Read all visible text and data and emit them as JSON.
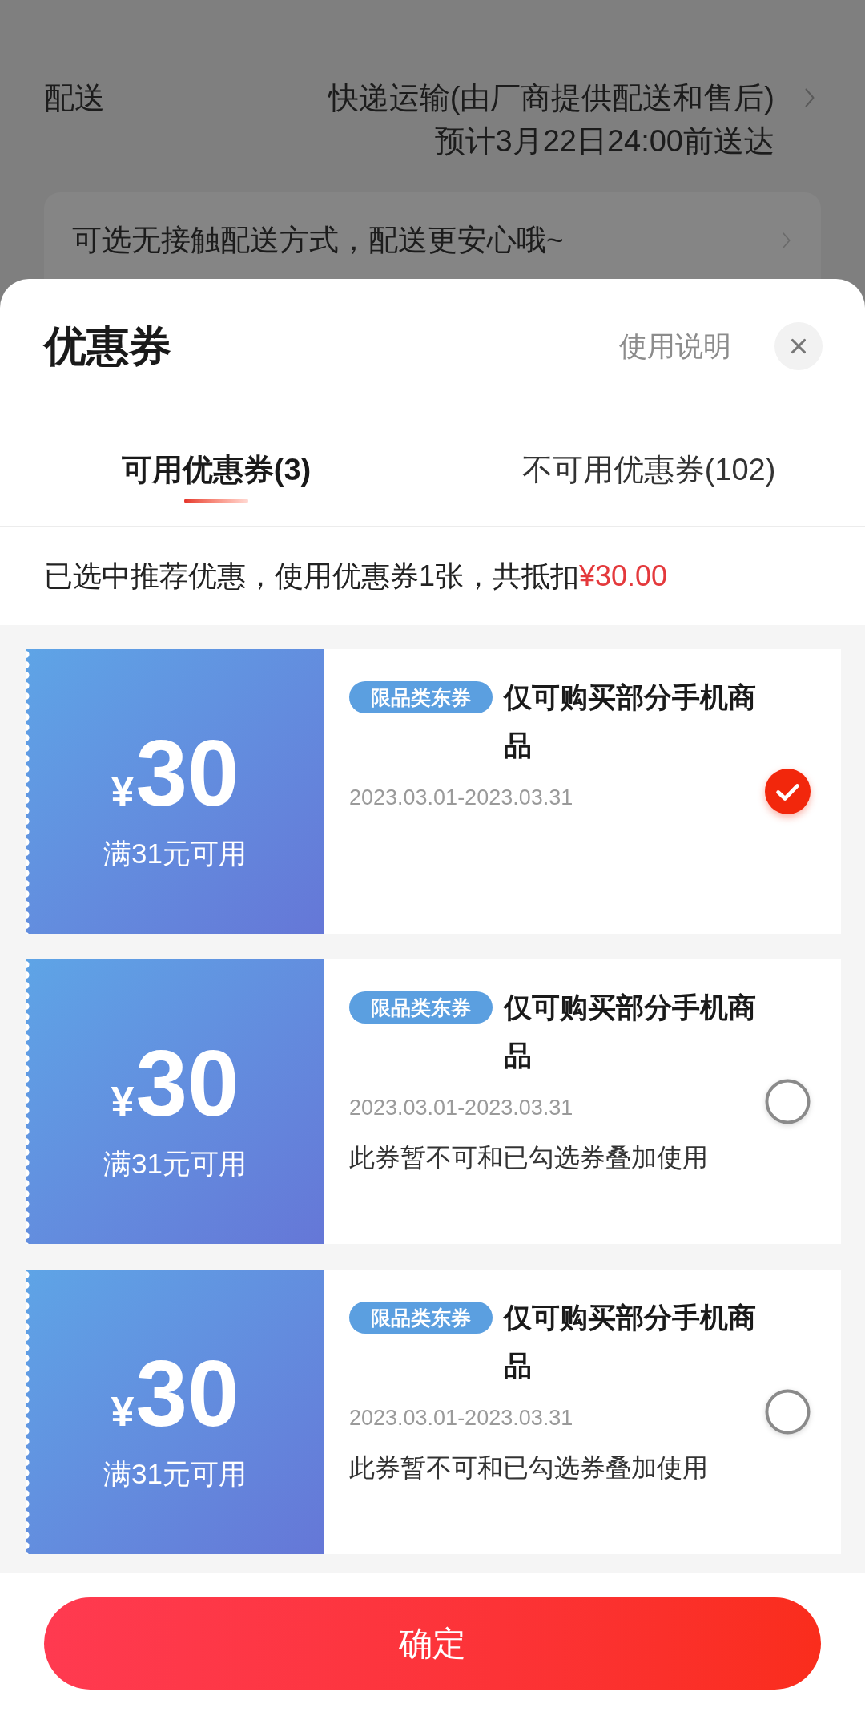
{
  "background_page": {
    "delivery": {
      "label": "配送",
      "method": "快递运输(由厂商提供配送和售后)",
      "estimate": "预计3月22日24:00前送达"
    },
    "contactless_banner": "可选无接触配送方式，配送更安心哦~"
  },
  "sheet": {
    "title": "优惠券",
    "help_link": "使用说明"
  },
  "tabs": [
    {
      "label": "可用优惠券(3)",
      "selected": true
    },
    {
      "label": "不可用优惠券(102)",
      "selected": false
    }
  ],
  "summary": {
    "text": "已选中推荐优惠，使用优惠券1张，共抵扣",
    "amount": "¥30.00"
  },
  "coupons": [
    {
      "currency": "¥",
      "amount": "30",
      "condition": "满31元可用",
      "tag": "限品类东券",
      "title": "仅可购买部分手机商品",
      "validity": "2023.03.01-2023.03.31",
      "selected": true
    },
    {
      "currency": "¥",
      "amount": "30",
      "condition": "满31元可用",
      "tag": "限品类东券",
      "title": "仅可购买部分手机商品",
      "validity": "2023.03.01-2023.03.31",
      "note": "此券暂不可和已勾选券叠加使用",
      "selected": false
    },
    {
      "currency": "¥",
      "amount": "30",
      "condition": "满31元可用",
      "tag": "限品类东券",
      "title": "仅可购买部分手机商品",
      "validity": "2023.03.01-2023.03.31",
      "note": "此券暂不可和已勾选券叠加使用",
      "selected": false
    }
  ],
  "confirm_button": "确定"
}
